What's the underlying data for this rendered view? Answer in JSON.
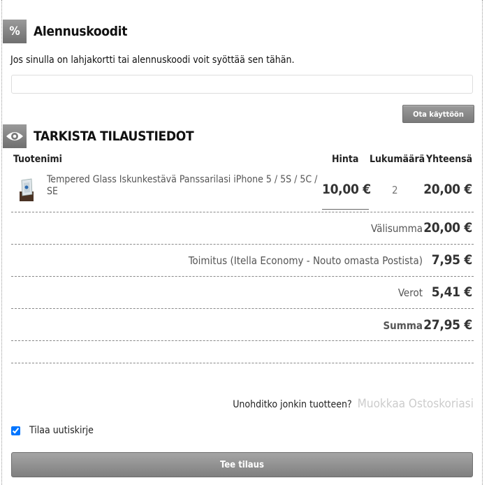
{
  "discount": {
    "icon": "%",
    "title": "Alennuskoodit",
    "description": "Jos sinulla on lahjakortti tai alennuskoodi voit syöttää sen tähän.",
    "input_value": "",
    "apply_label": "Ota käyttöön"
  },
  "review": {
    "title": "TARKISTA TILAUSTIEDOT",
    "columns": {
      "product": "Tuotenimi",
      "price": "Hinta",
      "quantity": "Lukumäärä",
      "total": "Yhteensä"
    },
    "items": [
      {
        "name": "Tempered Glass Iskunkestävä Panssarilasi iPhone 5 / 5S / 5C / SE",
        "price": "10,00 €",
        "quantity": "2",
        "total": "20,00 €"
      }
    ],
    "subtotal": {
      "label": "Välisumma",
      "value": "20,00 €"
    },
    "shipping": {
      "label": "Toimitus (Itella Economy - Nouto omasta Postista)",
      "value": "7,95 €"
    },
    "tax": {
      "label": "Verot",
      "value": "5,41 €"
    },
    "sum": {
      "label": "Summa",
      "value": "27,95 €"
    }
  },
  "forgot": {
    "text": "Unohditko jonkin tuotteen?",
    "link": "Muokkaa Ostoskoriasi"
  },
  "newsletter": {
    "label": "Tilaa uutiskirje",
    "checked": true
  },
  "submit_label": "Tee tilaus"
}
